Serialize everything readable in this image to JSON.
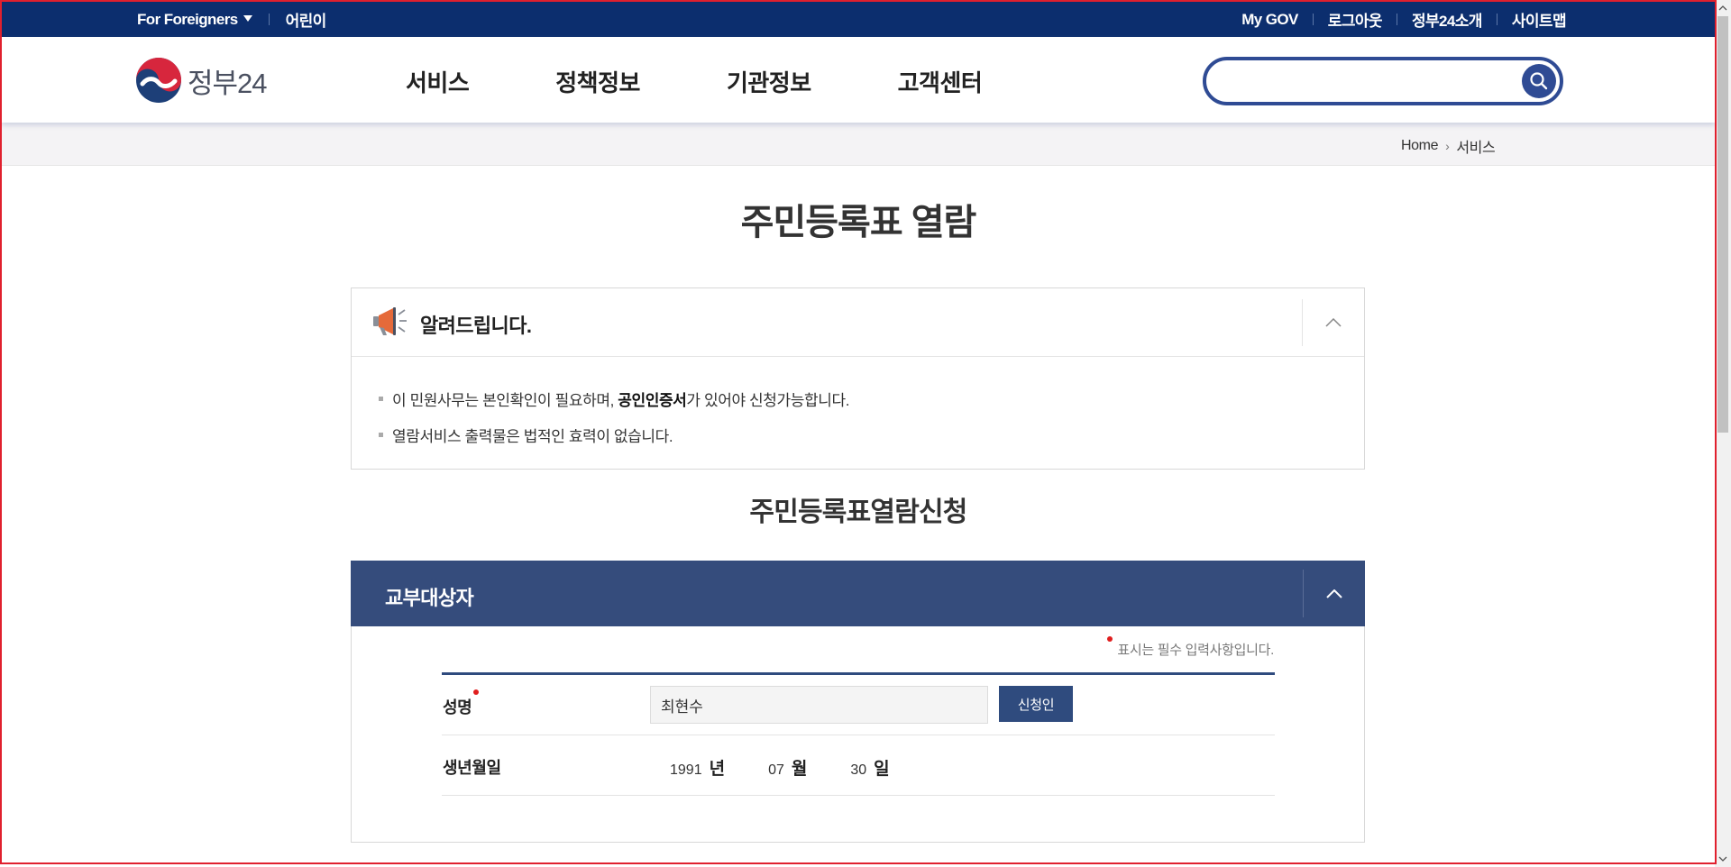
{
  "utility_bar": {
    "for_foreigners": "For Foreigners",
    "kids": "어린이",
    "links": [
      "My GOV",
      "로그아웃",
      "정부24소개",
      "사이트맵"
    ]
  },
  "header": {
    "logo_text": "정부24",
    "nav": [
      "서비스",
      "정책정보",
      "기관정보",
      "고객센터"
    ],
    "search": {
      "value": "",
      "placeholder": ""
    }
  },
  "breadcrumb": {
    "home": "Home",
    "current": "서비스"
  },
  "page_title": "주민등록표 열람",
  "notice": {
    "title": "알려드립니다.",
    "line1_pre": "이 민원사무는 본인확인이 필요하며, ",
    "line1_bold": "공인인증서",
    "line1_post": "가 있어야 신청가능합니다.",
    "line2": "열람서비스 출력물은 법적인 효력이 없습니다."
  },
  "section_title": "주민등록표열람신청",
  "panel": {
    "title": "교부대상자",
    "required_note": "표시는 필수 입력사항입니다.",
    "name_label": "성명",
    "name_value": "최현수",
    "applicant_button": "신청인",
    "dob_label": "생년월일",
    "dob_year": "1991",
    "dob_year_unit": "년",
    "dob_month": "07",
    "dob_month_unit": "월",
    "dob_day": "30",
    "dob_day_unit": "일"
  },
  "colors": {
    "utility_bar": "#0c2e6e",
    "brand_blue": "#2f4b94",
    "panel_head": "#354c7c",
    "required_dot": "#e01e1e",
    "frame": "#e0202e"
  },
  "icons": [
    "caret-down-icon",
    "search-icon",
    "megaphone-icon",
    "chevron-up-icon",
    "chevron-right-icon"
  ]
}
